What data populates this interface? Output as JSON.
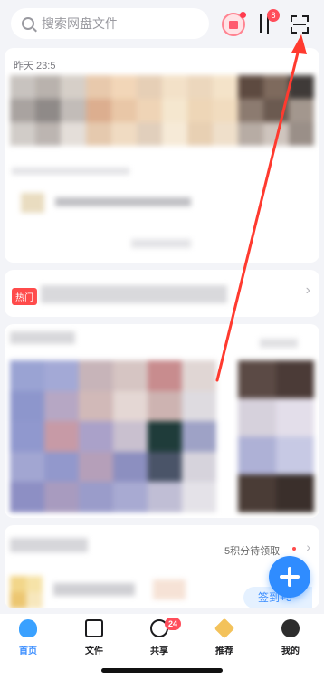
{
  "search": {
    "placeholder": "搜索网盘文件",
    "icon": "search-icon"
  },
  "header": {
    "gift_icon": "gift-icon",
    "transfer_badge": "8",
    "scan_icon": "scan-icon"
  },
  "feed": {
    "recent_timestamp": "昨天 23:5",
    "hot_tag": "热门",
    "more_glyph": "›"
  },
  "rewards": {
    "points_text": "5积分待领取",
    "points_arrow": "›",
    "signin_label": "签到+5"
  },
  "tabs": [
    {
      "label": "首页",
      "icon": "home-icon",
      "active": true
    },
    {
      "label": "文件",
      "icon": "folder-icon"
    },
    {
      "label": "共享",
      "icon": "share-icon",
      "badge": "24"
    },
    {
      "label": "推荐",
      "icon": "recommend-icon"
    },
    {
      "label": "我的",
      "icon": "profile-icon"
    }
  ],
  "colors": {
    "accent": "#2f8cff",
    "badge": "#ff4d5a",
    "annotation_arrow": "#ff3a2f"
  }
}
